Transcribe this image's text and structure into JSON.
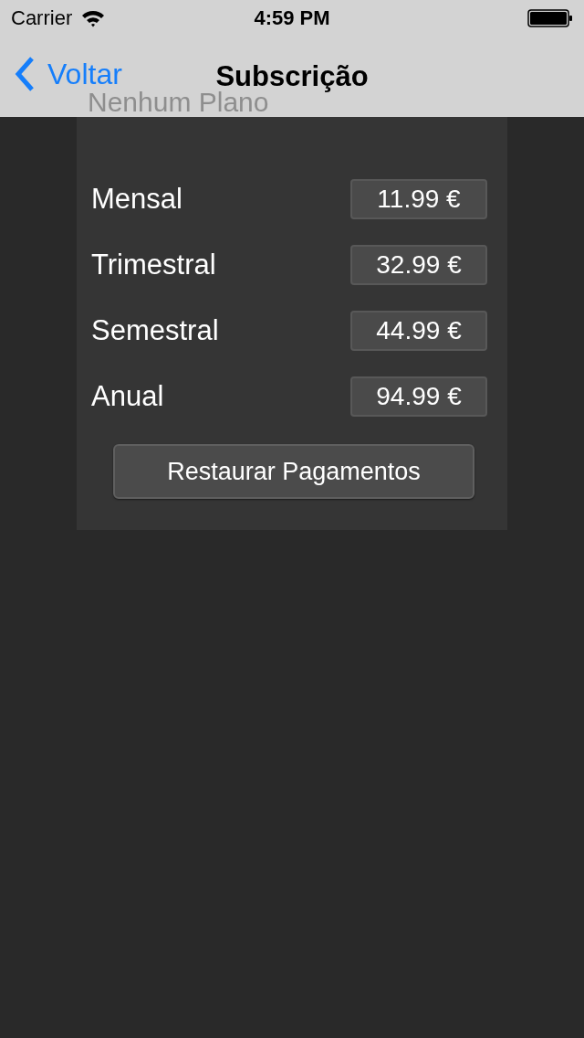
{
  "status_bar": {
    "carrier": "Carrier",
    "time": "4:59 PM"
  },
  "nav_bar": {
    "back_label": "Voltar",
    "title": "Subscrição"
  },
  "plan_status": "Nenhum Plano",
  "plans": [
    {
      "name": "Mensal",
      "price": "11.99 €"
    },
    {
      "name": "Trimestral",
      "price": "32.99 €"
    },
    {
      "name": "Semestral",
      "price": "44.99 €"
    },
    {
      "name": "Anual",
      "price": "94.99 €"
    }
  ],
  "restore_button": "Restaurar Pagamentos"
}
